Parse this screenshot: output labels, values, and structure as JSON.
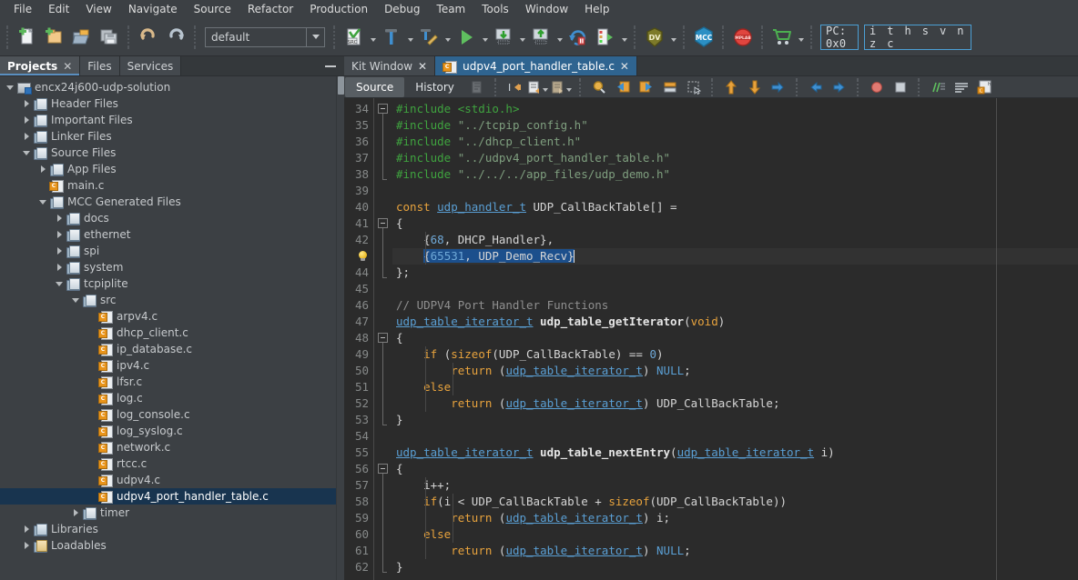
{
  "menubar": {
    "items": [
      {
        "label": "File",
        "accel": "F"
      },
      {
        "label": "Edit",
        "accel": "E"
      },
      {
        "label": "View",
        "accel": "V"
      },
      {
        "label": "Navigate",
        "accel": "N"
      },
      {
        "label": "Source",
        "accel": "S"
      },
      {
        "label": "Refactor",
        "accel": "a"
      },
      {
        "label": "Production",
        "accel": ""
      },
      {
        "label": "Debug",
        "accel": "D"
      },
      {
        "label": "Team",
        "accel": "m"
      },
      {
        "label": "Tools",
        "accel": "T"
      },
      {
        "label": "Window",
        "accel": "W"
      },
      {
        "label": "Help",
        "accel": "H"
      }
    ]
  },
  "toolbar": {
    "new_file_icon": "new-file-icon",
    "new_project_icon": "new-project-icon",
    "open_project_icon": "open-project-icon",
    "save_all_icon": "save-all-icon",
    "undo_icon": "undo-icon",
    "redo_icon": "redo-icon",
    "configuration": {
      "value": "default",
      "dropdown_icon": "chevron-down-icon"
    },
    "build_icon": "build-src-icon",
    "clean_build_icon": "clean-and-build-icon",
    "make_icon": "make-and-program-icon",
    "run_icon": "run-project-icon",
    "debug_download_icon": "program-device-icon",
    "debug_upload_icon": "read-device-icon",
    "reset_icon": "hold-in-reset-icon",
    "step_icon": "debug-project-icon",
    "dv_icon": "data-visualizer-icon",
    "mcc_icon": "mcc-icon",
    "kit_icon": "kit-window-icon",
    "cart_icon": "store-cart-icon",
    "pc_label": "PC: 0x0",
    "flags_label": "i t h s v n z c"
  },
  "left_panel": {
    "tabs": [
      {
        "label": "Projects",
        "closable": true,
        "active": true
      },
      {
        "label": "Files",
        "closable": false,
        "active": false
      },
      {
        "label": "Services",
        "closable": false,
        "active": false
      }
    ],
    "minimize_icon": "minimize-icon",
    "tree": [
      {
        "label": "encx24j600-udp-solution",
        "depth": 0,
        "twisty": "open",
        "icon": "project-root",
        "selected": false
      },
      {
        "label": "Header Files",
        "depth": 1,
        "twisty": "closed",
        "icon": "folder",
        "selected": false
      },
      {
        "label": "Important Files",
        "depth": 1,
        "twisty": "closed",
        "icon": "folder",
        "selected": false
      },
      {
        "label": "Linker Files",
        "depth": 1,
        "twisty": "closed",
        "icon": "folder",
        "selected": false
      },
      {
        "label": "Source Files",
        "depth": 1,
        "twisty": "open",
        "icon": "folder",
        "selected": false
      },
      {
        "label": "App Files",
        "depth": 2,
        "twisty": "closed",
        "icon": "folder",
        "selected": false
      },
      {
        "label": "main.c",
        "depth": 2,
        "twisty": "none",
        "icon": "cfile",
        "selected": false
      },
      {
        "label": "MCC Generated Files",
        "depth": 2,
        "twisty": "open",
        "icon": "folder",
        "selected": false
      },
      {
        "label": "docs",
        "depth": 3,
        "twisty": "closed",
        "icon": "folder",
        "selected": false
      },
      {
        "label": "ethernet",
        "depth": 3,
        "twisty": "closed",
        "icon": "folder",
        "selected": false
      },
      {
        "label": "spi",
        "depth": 3,
        "twisty": "closed",
        "icon": "folder",
        "selected": false
      },
      {
        "label": "system",
        "depth": 3,
        "twisty": "closed",
        "icon": "folder",
        "selected": false
      },
      {
        "label": "tcpiplite",
        "depth": 3,
        "twisty": "open",
        "icon": "folder",
        "selected": false
      },
      {
        "label": "src",
        "depth": 4,
        "twisty": "open",
        "icon": "folder",
        "selected": false
      },
      {
        "label": "arpv4.c",
        "depth": 5,
        "twisty": "none",
        "icon": "cfile",
        "selected": false
      },
      {
        "label": "dhcp_client.c",
        "depth": 5,
        "twisty": "none",
        "icon": "cfile",
        "selected": false
      },
      {
        "label": "ip_database.c",
        "depth": 5,
        "twisty": "none",
        "icon": "cfile",
        "selected": false
      },
      {
        "label": "ipv4.c",
        "depth": 5,
        "twisty": "none",
        "icon": "cfile",
        "selected": false
      },
      {
        "label": "lfsr.c",
        "depth": 5,
        "twisty": "none",
        "icon": "cfile",
        "selected": false
      },
      {
        "label": "log.c",
        "depth": 5,
        "twisty": "none",
        "icon": "cfile",
        "selected": false
      },
      {
        "label": "log_console.c",
        "depth": 5,
        "twisty": "none",
        "icon": "cfile",
        "selected": false
      },
      {
        "label": "log_syslog.c",
        "depth": 5,
        "twisty": "none",
        "icon": "cfile",
        "selected": false
      },
      {
        "label": "network.c",
        "depth": 5,
        "twisty": "none",
        "icon": "cfile",
        "selected": false
      },
      {
        "label": "rtcc.c",
        "depth": 5,
        "twisty": "none",
        "icon": "cfile",
        "selected": false
      },
      {
        "label": "udpv4.c",
        "depth": 5,
        "twisty": "none",
        "icon": "cfile",
        "selected": false
      },
      {
        "label": "udpv4_port_handler_table.c",
        "depth": 5,
        "twisty": "none",
        "icon": "cfile",
        "selected": true
      },
      {
        "label": "timer",
        "depth": 4,
        "twisty": "closed",
        "icon": "folder",
        "selected": false
      },
      {
        "label": "Libraries",
        "depth": 1,
        "twisty": "closed",
        "icon": "folder-lib",
        "selected": false
      },
      {
        "label": "Loadables",
        "depth": 1,
        "twisty": "closed",
        "icon": "folder-load",
        "selected": false
      }
    ]
  },
  "editor": {
    "tabs": [
      {
        "label": "Kit Window",
        "active": false,
        "icon": "none"
      },
      {
        "label": "udpv4_port_handler_table.c",
        "active": true,
        "icon": "cfile"
      }
    ],
    "view_tabs": [
      {
        "label": "Source",
        "active": true
      },
      {
        "label": "History",
        "active": false
      }
    ],
    "tool_icons": [
      "shift-left-icon",
      "comment-icon",
      "uncomment-icon",
      "find-selection-icon",
      "previous-bookmark-icon",
      "next-bookmark-icon",
      "toggle-bookmark-icon",
      "toggle-rectangular-selection-icon",
      "previous-error-icon",
      "next-error-icon",
      "shift-line-right-icon",
      "previous-edit-icon",
      "next-edit-icon",
      "toggle-breakpoint-icon",
      "stop-icon",
      "toggle-highlight-icon",
      "toggle-line-wrap-icon",
      "inspect-header-icon"
    ]
  },
  "code": {
    "first_line": 34,
    "lines": [
      {
        "n": "34",
        "tokens": [
          {
            "t": "#include ",
            "c": "pp"
          },
          {
            "t": "<stdio.h>",
            "c": "pp"
          }
        ]
      },
      {
        "n": "35",
        "tokens": [
          {
            "t": "#include ",
            "c": "pp"
          },
          {
            "t": "\"../tcpip_config.h\"",
            "c": "str"
          }
        ]
      },
      {
        "n": "36",
        "tokens": [
          {
            "t": "#include ",
            "c": "pp"
          },
          {
            "t": "\"../dhcp_client.h\"",
            "c": "str"
          }
        ]
      },
      {
        "n": "37",
        "tokens": [
          {
            "t": "#include ",
            "c": "pp"
          },
          {
            "t": "\"../udpv4_port_handler_table.h\"",
            "c": "str"
          }
        ]
      },
      {
        "n": "38",
        "tokens": [
          {
            "t": "#include ",
            "c": "pp"
          },
          {
            "t": "\"../../../app_files/udp_demo.h\"",
            "c": "str"
          }
        ]
      },
      {
        "n": "39",
        "tokens": []
      },
      {
        "n": "40",
        "tokens": [
          {
            "t": "const ",
            "c": "k"
          },
          {
            "t": "udp_handler_t",
            "c": "ty"
          },
          {
            "t": " ",
            "c": "id"
          },
          {
            "t": "UDP_CallBackTable",
            "c": "id"
          },
          {
            "t": "[] =",
            "c": "id"
          }
        ]
      },
      {
        "n": "41",
        "tokens": [
          {
            "t": "{",
            "c": "id"
          }
        ]
      },
      {
        "n": "42",
        "tokens": [
          {
            "t": "    {",
            "c": "id"
          },
          {
            "t": "68",
            "c": "num"
          },
          {
            "t": ", DHCP_Handler},",
            "c": "id"
          }
        ]
      },
      {
        "n": "43",
        "bulb": true,
        "selected": true,
        "tokens": [
          {
            "t": "    ",
            "c": "id"
          },
          {
            "t": "{",
            "c": "id"
          },
          {
            "t": "65531",
            "c": "num"
          },
          {
            "t": ", UDP_Demo_Recv}",
            "c": "id"
          }
        ]
      },
      {
        "n": "44",
        "tokens": [
          {
            "t": "};",
            "c": "id"
          }
        ]
      },
      {
        "n": "45",
        "tokens": []
      },
      {
        "n": "46",
        "tokens": [
          {
            "t": "// UDPV4 Port Handler Functions",
            "c": "cm"
          }
        ]
      },
      {
        "n": "47",
        "tokens": [
          {
            "t": "udp_table_iterator_t",
            "c": "ty"
          },
          {
            "t": " ",
            "c": "id"
          },
          {
            "t": "udp_table_getIterator",
            "c": "fn"
          },
          {
            "t": "(",
            "c": "id"
          },
          {
            "t": "void",
            "c": "k"
          },
          {
            "t": ")",
            "c": "id"
          }
        ]
      },
      {
        "n": "48",
        "tokens": [
          {
            "t": "{",
            "c": "id"
          }
        ]
      },
      {
        "n": "49",
        "tokens": [
          {
            "t": "    ",
            "c": "id"
          },
          {
            "t": "if",
            "c": "k"
          },
          {
            "t": " (",
            "c": "id"
          },
          {
            "t": "sizeof",
            "c": "k"
          },
          {
            "t": "(UDP_CallBackTable) == ",
            "c": "id"
          },
          {
            "t": "0",
            "c": "num"
          },
          {
            "t": ")",
            "c": "id"
          }
        ]
      },
      {
        "n": "50",
        "tokens": [
          {
            "t": "        ",
            "c": "id"
          },
          {
            "t": "return",
            "c": "k"
          },
          {
            "t": " (",
            "c": "id"
          },
          {
            "t": "udp_table_iterator_t",
            "c": "ty"
          },
          {
            "t": ") ",
            "c": "id"
          },
          {
            "t": "NULL",
            "c": "cst"
          },
          {
            "t": ";",
            "c": "id"
          }
        ]
      },
      {
        "n": "51",
        "tokens": [
          {
            "t": "    ",
            "c": "id"
          },
          {
            "t": "else",
            "c": "k"
          }
        ]
      },
      {
        "n": "52",
        "tokens": [
          {
            "t": "        ",
            "c": "id"
          },
          {
            "t": "return",
            "c": "k"
          },
          {
            "t": " (",
            "c": "id"
          },
          {
            "t": "udp_table_iterator_t",
            "c": "ty"
          },
          {
            "t": ") UDP_CallBackTable;",
            "c": "id"
          }
        ]
      },
      {
        "n": "53",
        "tokens": [
          {
            "t": "}",
            "c": "id"
          }
        ]
      },
      {
        "n": "54",
        "tokens": []
      },
      {
        "n": "55",
        "tokens": [
          {
            "t": "udp_table_iterator_t",
            "c": "ty"
          },
          {
            "t": " ",
            "c": "id"
          },
          {
            "t": "udp_table_nextEntry",
            "c": "fn"
          },
          {
            "t": "(",
            "c": "id"
          },
          {
            "t": "udp_table_iterator_t",
            "c": "ty"
          },
          {
            "t": " i)",
            "c": "id"
          }
        ]
      },
      {
        "n": "56",
        "tokens": [
          {
            "t": "{",
            "c": "id"
          }
        ]
      },
      {
        "n": "57",
        "tokens": [
          {
            "t": "    i++;",
            "c": "id"
          }
        ]
      },
      {
        "n": "58",
        "tokens": [
          {
            "t": "    ",
            "c": "id"
          },
          {
            "t": "if",
            "c": "k"
          },
          {
            "t": "(i < UDP_CallBackTable + ",
            "c": "id"
          },
          {
            "t": "sizeof",
            "c": "k"
          },
          {
            "t": "(UDP_CallBackTable))",
            "c": "id"
          }
        ]
      },
      {
        "n": "59",
        "tokens": [
          {
            "t": "        ",
            "c": "id"
          },
          {
            "t": "return",
            "c": "k"
          },
          {
            "t": " (",
            "c": "id"
          },
          {
            "t": "udp_table_iterator_t",
            "c": "ty"
          },
          {
            "t": ") i;",
            "c": "id"
          }
        ]
      },
      {
        "n": "60",
        "tokens": [
          {
            "t": "    ",
            "c": "id"
          },
          {
            "t": "else",
            "c": "k"
          }
        ]
      },
      {
        "n": "61",
        "tokens": [
          {
            "t": "        ",
            "c": "id"
          },
          {
            "t": "return",
            "c": "k"
          },
          {
            "t": " (",
            "c": "id"
          },
          {
            "t": "udp_table_iterator_t",
            "c": "ty"
          },
          {
            "t": ") ",
            "c": "id"
          },
          {
            "t": "NULL",
            "c": "cst"
          },
          {
            "t": ";",
            "c": "id"
          }
        ]
      },
      {
        "n": "62",
        "tokens": [
          {
            "t": "}",
            "c": "id"
          }
        ]
      }
    ]
  },
  "colors": {
    "window_bg": "#3c4044",
    "editor_bg": "#2b2b2b",
    "selection": "#1c4f8c",
    "tree_selection": "#18344f",
    "tab_active": "#2f6490",
    "accent_border": "#4b9fd5",
    "keyword": "#e8a33d",
    "preprocessor": "#3fa33f",
    "string": "#7f9f7f",
    "comment": "#8f8f8f",
    "type": "#5a9fd4",
    "number": "#6fa9d8"
  }
}
